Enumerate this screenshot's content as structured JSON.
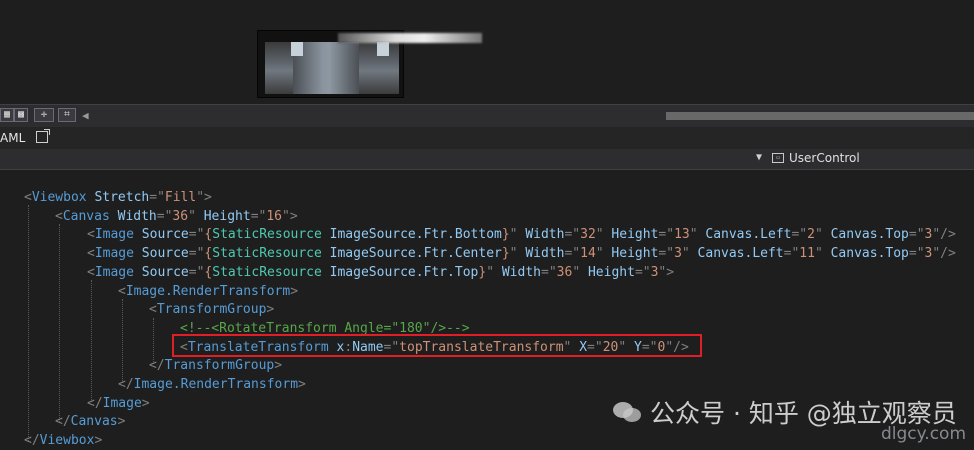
{
  "tabs": {
    "active_label": "AML"
  },
  "navbar": {
    "scope_label": "UserControl"
  },
  "toolbar": {
    "icons": [
      "grid-icon",
      "checker-icon",
      "snap-icon",
      "xy-icon"
    ]
  },
  "code_lines": [
    [
      [
        "d",
        "<"
      ],
      [
        "e",
        "Viewbox"
      ],
      [
        "a",
        " Stretch"
      ],
      [
        "d",
        "=\""
      ],
      [
        "v",
        "Fill"
      ],
      [
        "d",
        "\">"
      ]
    ],
    [
      [
        "d",
        "<"
      ],
      [
        "e",
        "Canvas"
      ],
      [
        "a",
        " Width"
      ],
      [
        "d",
        "=\""
      ],
      [
        "v",
        "36"
      ],
      [
        "d",
        "\""
      ],
      [
        "a",
        " Height"
      ],
      [
        "d",
        "=\""
      ],
      [
        "v",
        "16"
      ],
      [
        "d",
        "\">"
      ]
    ],
    [
      [
        "d",
        "<"
      ],
      [
        "e",
        "Image"
      ],
      [
        "a",
        " Source"
      ],
      [
        "d",
        "=\""
      ],
      [
        "v",
        "{"
      ],
      [
        "s",
        "StaticResource"
      ],
      [
        "a",
        " ImageSource.Ftr.Bottom"
      ],
      [
        "v",
        "}"
      ],
      [
        "d",
        "\""
      ],
      [
        "a",
        " Width"
      ],
      [
        "d",
        "=\""
      ],
      [
        "v",
        "32"
      ],
      [
        "d",
        "\""
      ],
      [
        "a",
        " Height"
      ],
      [
        "d",
        "=\""
      ],
      [
        "v",
        "13"
      ],
      [
        "d",
        "\""
      ],
      [
        "a",
        " Canvas.Left"
      ],
      [
        "d",
        "=\""
      ],
      [
        "v",
        "2"
      ],
      [
        "d",
        "\""
      ],
      [
        "a",
        " Canvas.Top"
      ],
      [
        "d",
        "=\""
      ],
      [
        "v",
        "3"
      ],
      [
        "d",
        "\"/>"
      ]
    ],
    [
      [
        "d",
        "<"
      ],
      [
        "e",
        "Image"
      ],
      [
        "a",
        " Source"
      ],
      [
        "d",
        "=\""
      ],
      [
        "v",
        "{"
      ],
      [
        "s",
        "StaticResource"
      ],
      [
        "a",
        " ImageSource.Ftr.Center"
      ],
      [
        "v",
        "}"
      ],
      [
        "d",
        "\""
      ],
      [
        "a",
        " Width"
      ],
      [
        "d",
        "=\""
      ],
      [
        "v",
        "14"
      ],
      [
        "d",
        "\""
      ],
      [
        "a",
        " Height"
      ],
      [
        "d",
        "=\""
      ],
      [
        "v",
        "3"
      ],
      [
        "d",
        "\""
      ],
      [
        "a",
        " Canvas.Left"
      ],
      [
        "d",
        "=\""
      ],
      [
        "v",
        "11"
      ],
      [
        "d",
        "\""
      ],
      [
        "a",
        " Canvas.Top"
      ],
      [
        "d",
        "=\""
      ],
      [
        "v",
        "3"
      ],
      [
        "d",
        "\"/>"
      ]
    ],
    [
      [
        "d",
        "<"
      ],
      [
        "e",
        "Image"
      ],
      [
        "a",
        " Source"
      ],
      [
        "d",
        "=\""
      ],
      [
        "v",
        "{"
      ],
      [
        "s",
        "StaticResource"
      ],
      [
        "a",
        " ImageSource.Ftr.Top"
      ],
      [
        "v",
        "}"
      ],
      [
        "d",
        "\""
      ],
      [
        "a",
        " Width"
      ],
      [
        "d",
        "=\""
      ],
      [
        "v",
        "36"
      ],
      [
        "d",
        "\""
      ],
      [
        "a",
        " Height"
      ],
      [
        "d",
        "=\""
      ],
      [
        "v",
        "3"
      ],
      [
        "d",
        "\">"
      ]
    ],
    [
      [
        "d",
        "<"
      ],
      [
        "e",
        "Image.RenderTransform"
      ],
      [
        "d",
        ">"
      ]
    ],
    [
      [
        "d",
        "<"
      ],
      [
        "e",
        "TransformGroup"
      ],
      [
        "d",
        ">"
      ]
    ],
    [
      [
        "c",
        "<!--<RotateTransform Angle=\"180\"/>-->"
      ]
    ],
    [
      [
        "d",
        "<"
      ],
      [
        "e",
        "TranslateTransform"
      ],
      [
        "a",
        " x"
      ],
      [
        "d",
        ":"
      ],
      [
        "a",
        "Name"
      ],
      [
        "d",
        "=\""
      ],
      [
        "v",
        "topTranslateTransform"
      ],
      [
        "d",
        "\""
      ],
      [
        "a",
        " X"
      ],
      [
        "d",
        "=\""
      ],
      [
        "v",
        "20"
      ],
      [
        "d",
        "\""
      ],
      [
        "a",
        " Y"
      ],
      [
        "d",
        "=\""
      ],
      [
        "v",
        "0"
      ],
      [
        "d",
        "\"/>"
      ]
    ],
    [
      [
        "d",
        "</"
      ],
      [
        "e",
        "TransformGroup"
      ],
      [
        "d",
        ">"
      ]
    ],
    [
      [
        "d",
        "</"
      ],
      [
        "e",
        "Image.RenderTransform"
      ],
      [
        "d",
        ">"
      ]
    ],
    [
      [
        "d",
        "</"
      ],
      [
        "e",
        "Image"
      ],
      [
        "d",
        ">"
      ]
    ],
    [
      [
        "d",
        "</"
      ],
      [
        "e",
        "Canvas"
      ],
      [
        "d",
        ">"
      ]
    ],
    [
      [
        "d",
        "</"
      ],
      [
        "e",
        "Viewbox"
      ],
      [
        "d",
        ">"
      ]
    ]
  ],
  "watermark": {
    "title": "公众号 · 知乎 @独立观察员",
    "site": "dlgcy.com"
  }
}
